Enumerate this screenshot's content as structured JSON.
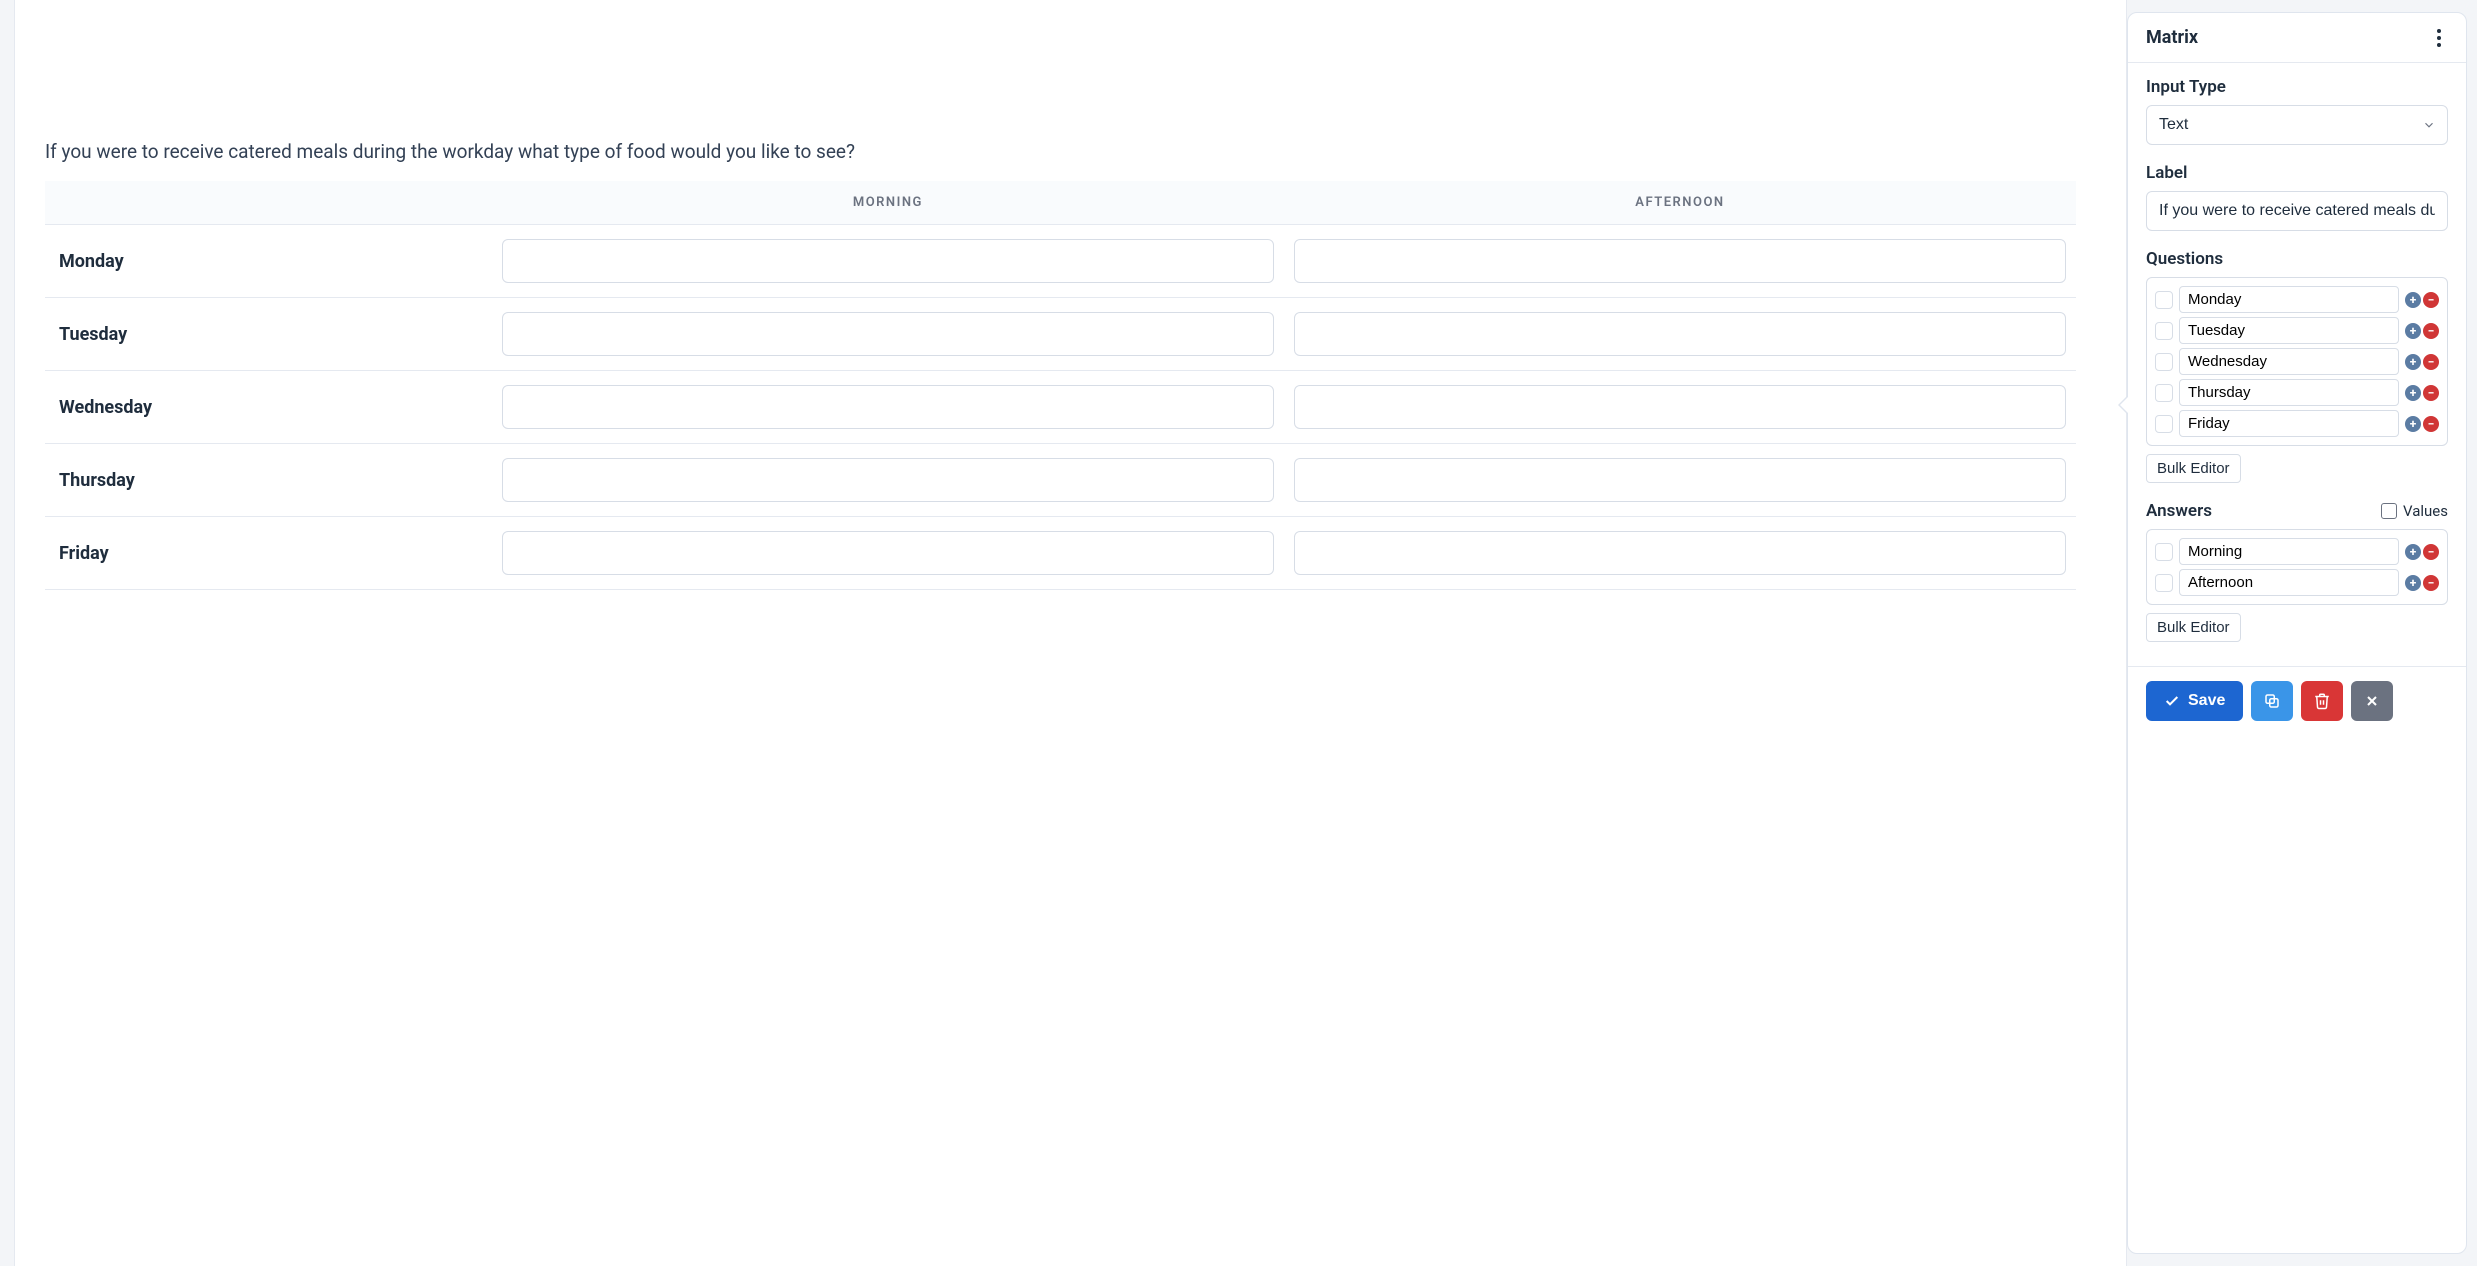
{
  "main": {
    "question_label": "If you were to receive catered meals during the workday what type of food would you like to see?",
    "columns": [
      "MORNING",
      "AFTERNOON"
    ],
    "rows": [
      "Monday",
      "Tuesday",
      "Wednesday",
      "Thursday",
      "Friday"
    ]
  },
  "panel": {
    "title": "Matrix",
    "input_type_label": "Input Type",
    "input_type_value": "Text",
    "label_label": "Label",
    "label_value": "If you were to receive catered meals during the workday what type of food would you like to see?",
    "questions_label": "Questions",
    "questions": [
      "Monday",
      "Tuesday",
      "Wednesday",
      "Thursday",
      "Friday"
    ],
    "answers_label": "Answers",
    "values_label": "Values",
    "answers": [
      "Morning",
      "Afternoon"
    ],
    "bulk_editor_label": "Bulk Editor",
    "save_label": "Save"
  }
}
